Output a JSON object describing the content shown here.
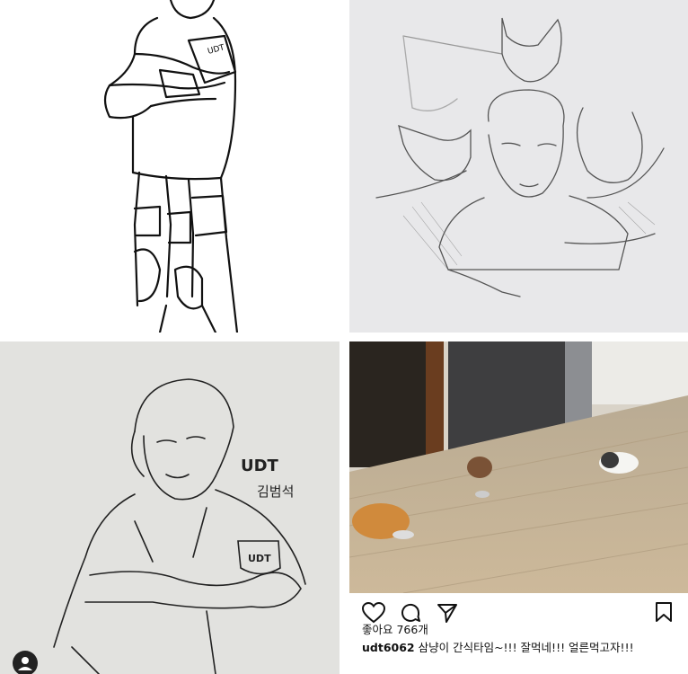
{
  "drawing_labels": {
    "unit": "UDT",
    "name": "김범석",
    "patch_top": "UDT",
    "patch_bottom": "UDT"
  },
  "post": {
    "likes": "좋아요 766개",
    "username": "udt6062",
    "caption": " 삼냥이 간식타임~!!! 잘먹네!!! 얼른먹고자!!!"
  },
  "icons": [
    "heart-icon",
    "comment-icon",
    "share-icon",
    "bookmark-icon",
    "profile-icon"
  ]
}
